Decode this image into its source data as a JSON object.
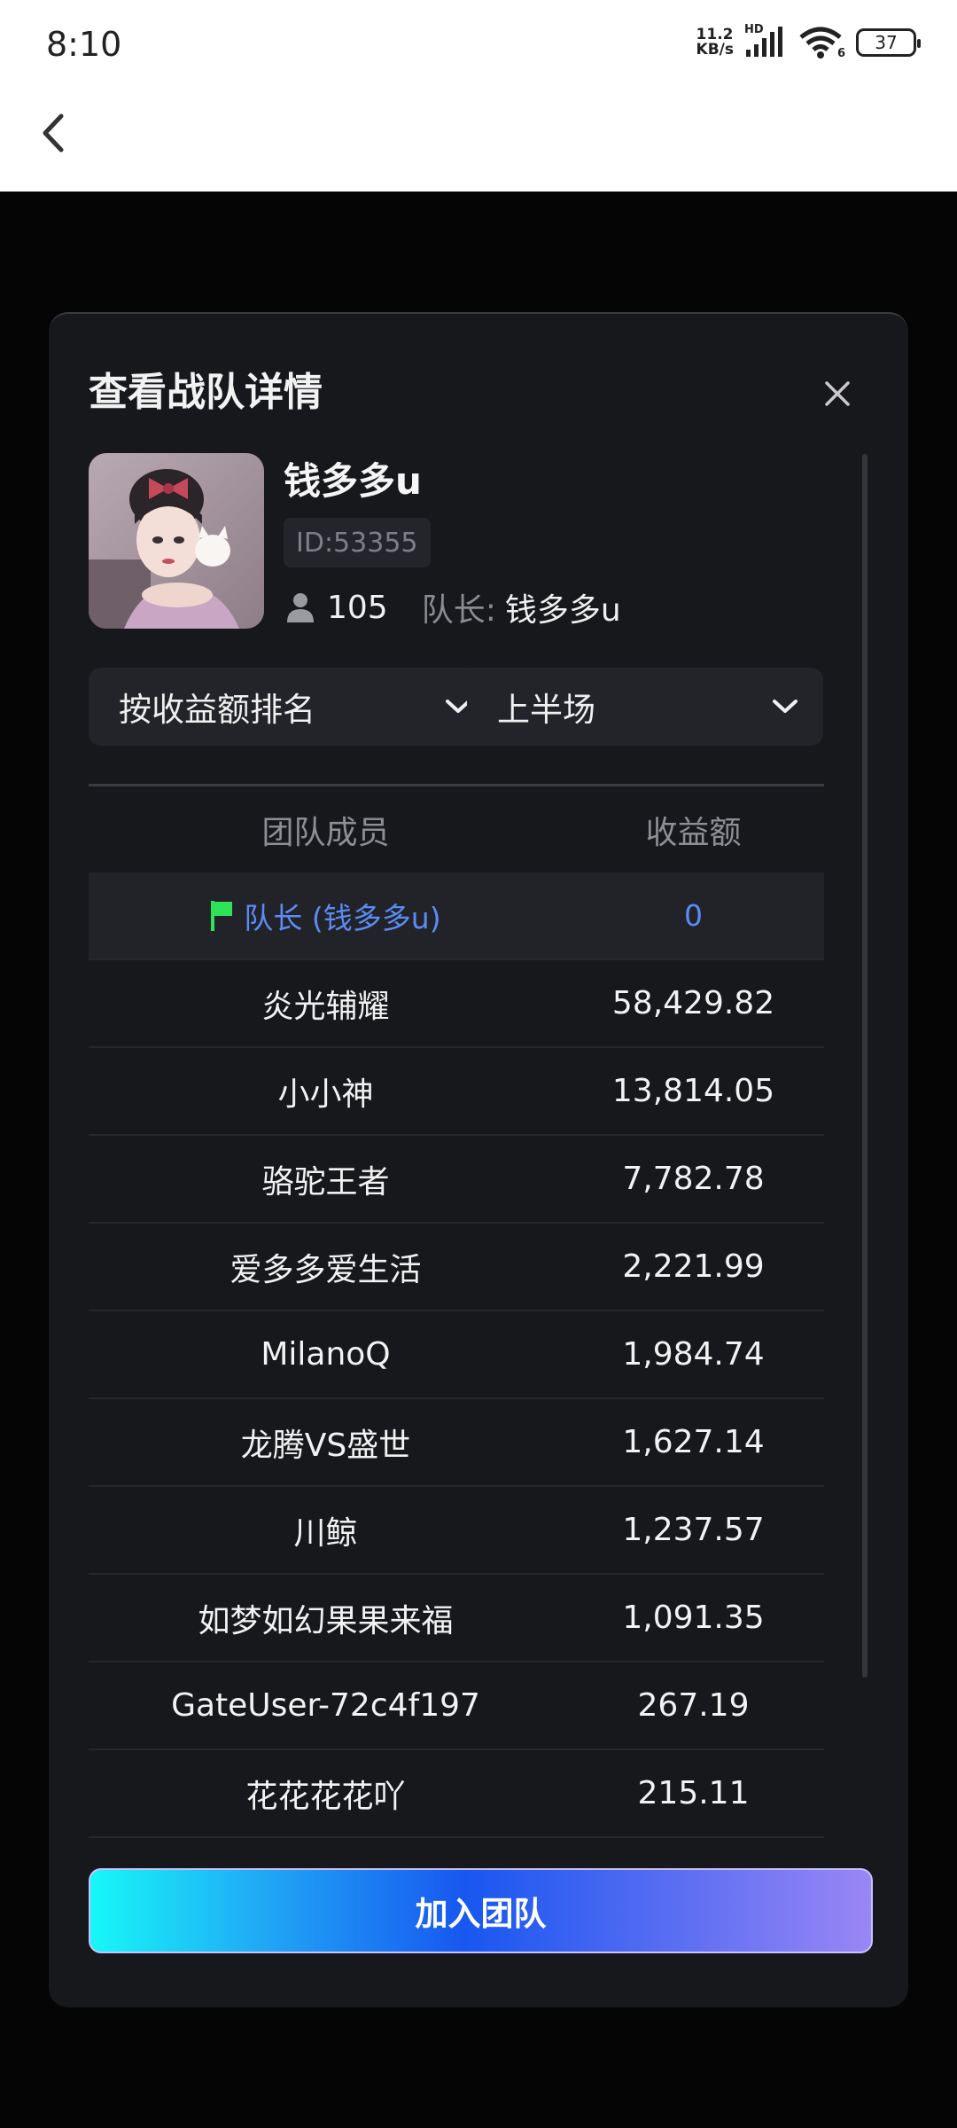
{
  "status_bar": {
    "time": "8:10",
    "net_speed_value": "11.2",
    "net_speed_unit": "KB/s",
    "network_type": "HD",
    "wifi_label": "6",
    "battery": "37"
  },
  "modal": {
    "title": "查看战队详情",
    "team": {
      "name": "钱多多u",
      "id": "ID:53355",
      "member_count": "105",
      "leader_label": "队长:",
      "leader_name": "钱多多u"
    },
    "sort_dropdown": {
      "selected": "按收益额排名"
    },
    "period_dropdown": {
      "selected": "上半场"
    },
    "table": {
      "headers": {
        "member": "团队成员",
        "earnings": "收益额"
      },
      "leader_row": {
        "name": "队长 (钱多多u)",
        "value": "0"
      },
      "rows": [
        {
          "name": "炎光辅耀",
          "value": "58,429.82"
        },
        {
          "name": "小小神",
          "value": "13,814.05"
        },
        {
          "name": "骆驼王者",
          "value": "7,782.78"
        },
        {
          "name": "爱多多爱生活",
          "value": "2,221.99"
        },
        {
          "name": "MilanoQ",
          "value": "1,984.74"
        },
        {
          "name": "龙腾VS盛世",
          "value": "1,627.14"
        },
        {
          "name": "川鲸",
          "value": "1,237.57"
        },
        {
          "name": "如梦如幻果果来福",
          "value": "1,091.35"
        },
        {
          "name": "GateUser-72c4f197",
          "value": "267.19"
        },
        {
          "name": "花花花花吖",
          "value": "215.11"
        }
      ]
    },
    "join_button": "加入团队"
  },
  "colors": {
    "modal_bg": "#17181c",
    "accent_blue": "#5b8cf5",
    "flag_green": "#2ee35a"
  }
}
